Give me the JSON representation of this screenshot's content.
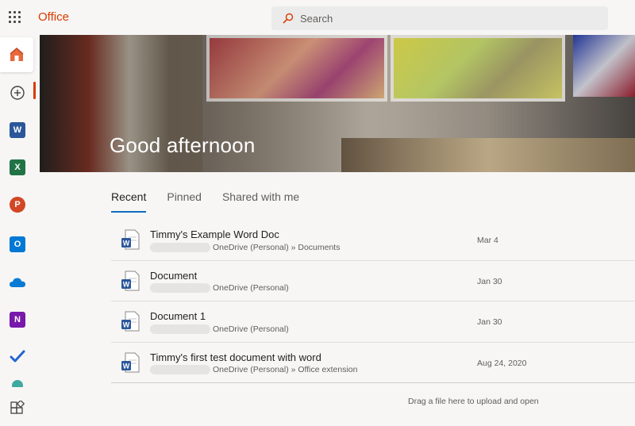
{
  "header": {
    "brand": "Office",
    "search_placeholder": "Search"
  },
  "colors": {
    "brand": "#d83b01",
    "word": "#2b579a",
    "excel": "#217346",
    "powerpoint": "#d24726",
    "outlook": "#0078d4",
    "onedrive": "#0a7bd5",
    "onenote": "#7719aa",
    "todo": "#2564cf",
    "active_tab_underline": "#0f6cbd"
  },
  "rail": {
    "items": [
      {
        "name": "home",
        "icon": "home-icon",
        "active": true
      },
      {
        "name": "create",
        "icon": "plus-circle-icon"
      },
      {
        "name": "word",
        "icon": "word-icon",
        "letter": "W"
      },
      {
        "name": "excel",
        "icon": "excel-icon",
        "letter": "X"
      },
      {
        "name": "powerpoint",
        "icon": "powerpoint-icon",
        "letter": "P"
      },
      {
        "name": "outlook",
        "icon": "outlook-icon",
        "letter": "O"
      },
      {
        "name": "onedrive",
        "icon": "onedrive-icon"
      },
      {
        "name": "onenote",
        "icon": "onenote-icon",
        "letter": "N"
      },
      {
        "name": "todo",
        "icon": "checkmark-icon"
      },
      {
        "name": "all-apps",
        "icon": "all-apps-icon"
      }
    ]
  },
  "hero": {
    "greeting": "Good afternoon"
  },
  "tabs": [
    {
      "label": "Recent",
      "active": true
    },
    {
      "label": "Pinned"
    },
    {
      "label": "Shared with me"
    }
  ],
  "files": [
    {
      "name": "Timmy's Example Word Doc",
      "location": "OneDrive (Personal) » Documents",
      "date": "Mar 4",
      "icon": "word-doc-icon"
    },
    {
      "name": "Document",
      "location": "OneDrive (Personal)",
      "date": "Jan 30",
      "icon": "word-doc-icon"
    },
    {
      "name": "Document 1",
      "location": "OneDrive (Personal)",
      "date": "Jan 30",
      "icon": "word-doc-icon"
    },
    {
      "name": "Timmy's first test document with word",
      "location": "OneDrive (Personal) » Office extension",
      "date": "Aug 24, 2020",
      "icon": "word-doc-icon"
    }
  ],
  "dropzone": {
    "text": "Drag a file here to upload and open"
  }
}
